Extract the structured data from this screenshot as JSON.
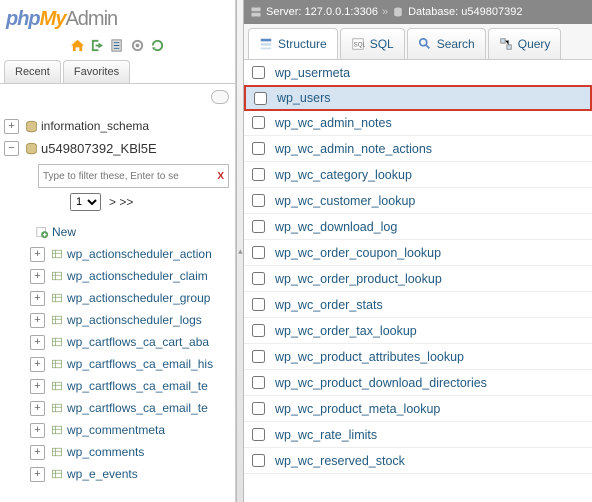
{
  "logo": {
    "p1": "php",
    "p2": "My",
    "p3": "Admin"
  },
  "sidebar": {
    "tabs": [
      "Recent",
      "Favorites"
    ],
    "db1": "information_schema",
    "db2": "u549807392_KBl5E",
    "filter_placeholder": "Type to filter these, Enter to se",
    "pager_select": "1",
    "pager_next": "> >>",
    "new_label": "New",
    "tables": [
      "wp_actionscheduler_action",
      "wp_actionscheduler_claim",
      "wp_actionscheduler_group",
      "wp_actionscheduler_logs",
      "wp_cartflows_ca_cart_aba",
      "wp_cartflows_ca_email_his",
      "wp_cartflows_ca_email_te",
      "wp_cartflows_ca_email_te",
      "wp_commentmeta",
      "wp_comments",
      "wp_e_events"
    ]
  },
  "breadcrumb": {
    "server_label": "Server:",
    "server_val": "127.0.0.1:3306",
    "db_label": "Database:",
    "db_val": "u549807392"
  },
  "maintabs": [
    "Structure",
    "SQL",
    "Search",
    "Query"
  ],
  "tables": [
    {
      "name": "wp_usermeta"
    },
    {
      "name": "wp_users",
      "highlight": true
    },
    {
      "name": "wp_wc_admin_notes"
    },
    {
      "name": "wp_wc_admin_note_actions"
    },
    {
      "name": "wp_wc_category_lookup"
    },
    {
      "name": "wp_wc_customer_lookup"
    },
    {
      "name": "wp_wc_download_log"
    },
    {
      "name": "wp_wc_order_coupon_lookup"
    },
    {
      "name": "wp_wc_order_product_lookup"
    },
    {
      "name": "wp_wc_order_stats"
    },
    {
      "name": "wp_wc_order_tax_lookup"
    },
    {
      "name": "wp_wc_product_attributes_lookup"
    },
    {
      "name": "wp_wc_product_download_directories"
    },
    {
      "name": "wp_wc_product_meta_lookup"
    },
    {
      "name": "wp_wc_rate_limits"
    },
    {
      "name": "wp_wc_reserved_stock"
    }
  ]
}
